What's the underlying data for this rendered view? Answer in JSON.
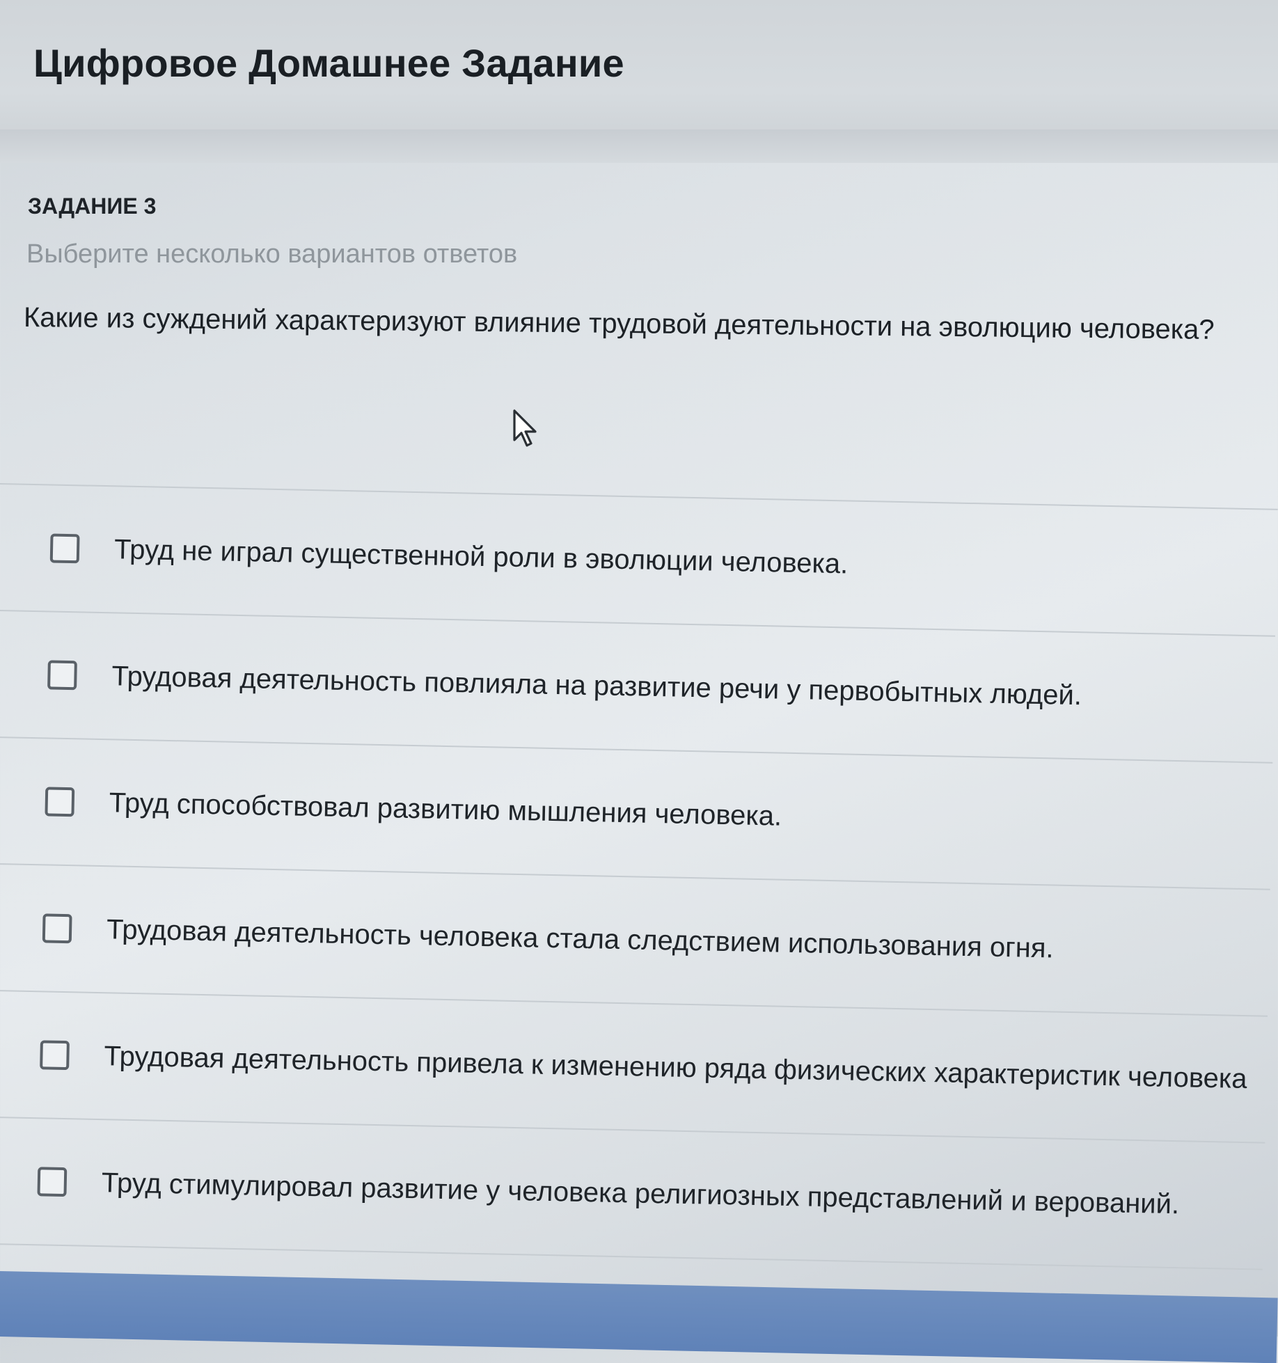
{
  "header": {
    "title": "Цифровое Домашнее Задание"
  },
  "task": {
    "label": "ЗАДАНИЕ 3",
    "instruction": "Выберите несколько вариантов ответов",
    "question": "Какие из суждений характеризуют влияние трудовой деятельности на эволюцию человека?"
  },
  "options": [
    {
      "label": "Труд не играл существенной роли в эволюции человека.",
      "checked": false
    },
    {
      "label": "Трудовая деятельность повлияла на развитие речи у первобытных людей.",
      "checked": false
    },
    {
      "label": "Труд способствовал развитию мышления человека.",
      "checked": false
    },
    {
      "label": "Трудовая деятельность человека стала следствием использования огня.",
      "checked": false
    },
    {
      "label": "Трудовая деятельность привела к изменению ряда физических характеристик человека",
      "checked": false
    },
    {
      "label": "Труд стимулировал развитие у человека религиозных представлений и верований.",
      "checked": false
    }
  ],
  "colors": {
    "submit_bar": "#6385b9",
    "checkbox_border": "#5a6168",
    "instruction_text": "#8f969c"
  },
  "icons": {
    "cursor": "mouse-pointer-icon"
  }
}
